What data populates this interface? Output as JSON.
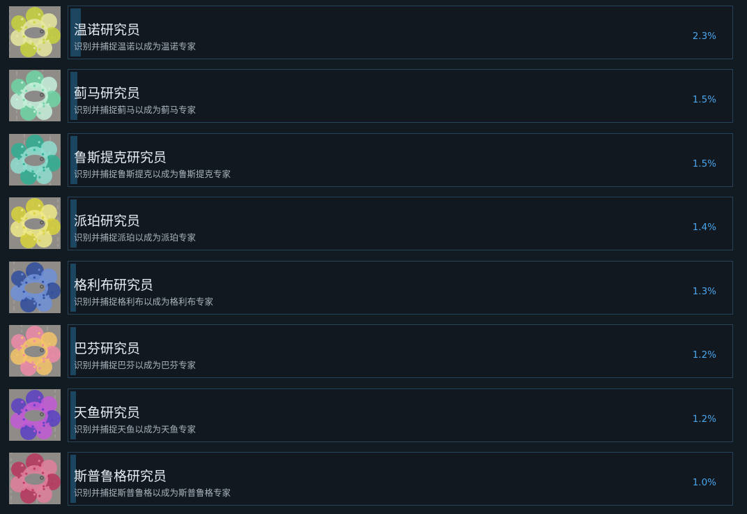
{
  "achievements": [
    {
      "title": "温诺研究员",
      "description": "识别并捕捉温诺以成为温诺专家",
      "percent_text": "2.3%",
      "percent": 2.3,
      "icon": "wenno-badge-icon",
      "colors": [
        "#c8d23c",
        "#e6e8a0"
      ]
    },
    {
      "title": "蓟马研究员",
      "description": "识别并捕捉蓟马以成为蓟马专家",
      "percent_text": "1.5%",
      "percent": 1.5,
      "icon": "thistle-horse-badge-icon",
      "colors": [
        "#6fd3a5",
        "#c6f0da"
      ]
    },
    {
      "title": "鲁斯提克研究员",
      "description": "识别并捕捉鲁斯提克以成为鲁斯提克专家",
      "percent_text": "1.5%",
      "percent": 1.5,
      "icon": "rustic-badge-icon",
      "colors": [
        "#2fae93",
        "#8fded0"
      ]
    },
    {
      "title": "派珀研究员",
      "description": "识别并捕捉派珀以成为派珀专家",
      "percent_text": "1.4%",
      "percent": 1.4,
      "icon": "piper-badge-icon",
      "colors": [
        "#d8d23a",
        "#efe98a"
      ]
    },
    {
      "title": "格利布研究员",
      "description": "识别并捕捉格利布以成为格利布专家",
      "percent_text": "1.3%",
      "percent": 1.3,
      "icon": "glib-badge-icon",
      "colors": [
        "#2f4d9e",
        "#6f8fd8"
      ]
    },
    {
      "title": "巴芬研究员",
      "description": "识别并捕捉巴芬以成为巴芬专家",
      "percent_text": "1.2%",
      "percent": 1.2,
      "icon": "buffin-badge-icon",
      "colors": [
        "#f08aa8",
        "#f4c46a"
      ]
    },
    {
      "title": "天鱼研究员",
      "description": "识别并捕捉天鱼以成为天鱼专家",
      "percent_text": "1.2%",
      "percent": 1.2,
      "icon": "sky-fish-badge-icon",
      "colors": [
        "#5b3fc4",
        "#c25ad6"
      ]
    },
    {
      "title": "斯普鲁格研究员",
      "description": "识别并捕捉斯普鲁格以成为斯普鲁格专家",
      "percent_text": "1.0%",
      "percent": 1.0,
      "icon": "sprug-badge-icon",
      "colors": [
        "#b8365f",
        "#e07f9c"
      ]
    }
  ]
}
